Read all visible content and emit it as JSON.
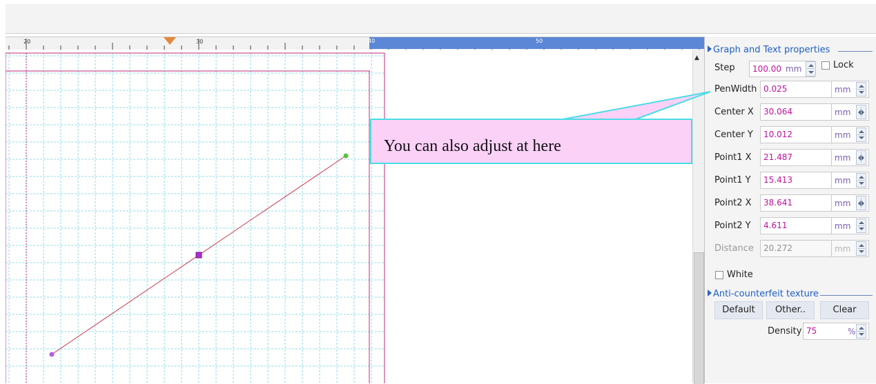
{
  "ruler": {
    "labels": [
      "20",
      "30",
      "40",
      "50"
    ]
  },
  "callout": {
    "text": "You can also adjust at here"
  },
  "panel": {
    "section_graph": {
      "title": "Graph and Text properties"
    },
    "step": {
      "label": "Step",
      "value": "100.00",
      "unit": "mm",
      "lock_label": "Lock",
      "lock_checked": false
    },
    "fields": [
      {
        "label": "PenWidth",
        "value": "0.025",
        "unit": "mm",
        "control": "spinner-vertical",
        "enabled": true
      },
      {
        "label": "Center X",
        "value": "30.064",
        "unit": "mm",
        "control": "spinner-horizontal",
        "enabled": true
      },
      {
        "label": "Center Y",
        "value": "10.012",
        "unit": "mm",
        "control": "spinner-vertical",
        "enabled": true
      },
      {
        "label": "Point1 X",
        "value": "21.487",
        "unit": "mm",
        "control": "spinner-horizontal",
        "enabled": true
      },
      {
        "label": "Point1 Y",
        "value": "15.413",
        "unit": "mm",
        "control": "spinner-vertical",
        "enabled": true
      },
      {
        "label": "Point2 X",
        "value": "38.641",
        "unit": "mm",
        "control": "spinner-horizontal",
        "enabled": true
      },
      {
        "label": "Point2 Y",
        "value": "4.611",
        "unit": "mm",
        "control": "spinner-vertical",
        "enabled": true
      },
      {
        "label": "Distance",
        "value": "20.272",
        "unit": "mm",
        "control": "spinner-vertical",
        "enabled": false
      }
    ],
    "white": {
      "label": "White",
      "checked": false
    },
    "section_anti": {
      "title": "Anti-counterfeit texture"
    },
    "buttons": {
      "default": "Default",
      "other": "Other..",
      "clear": "Clear"
    },
    "density": {
      "label": "Density",
      "value": "75",
      "unit": "%"
    }
  },
  "colors": {
    "grid": "#8fdde8",
    "page_border": "#c0287a",
    "line": "#d0354a",
    "accent": "#1e5fbf",
    "value_text": "#c0119c",
    "callout_fill": "#fbd1f8",
    "callout_border": "#49dde6",
    "ruler_active": "#5b87d6"
  }
}
